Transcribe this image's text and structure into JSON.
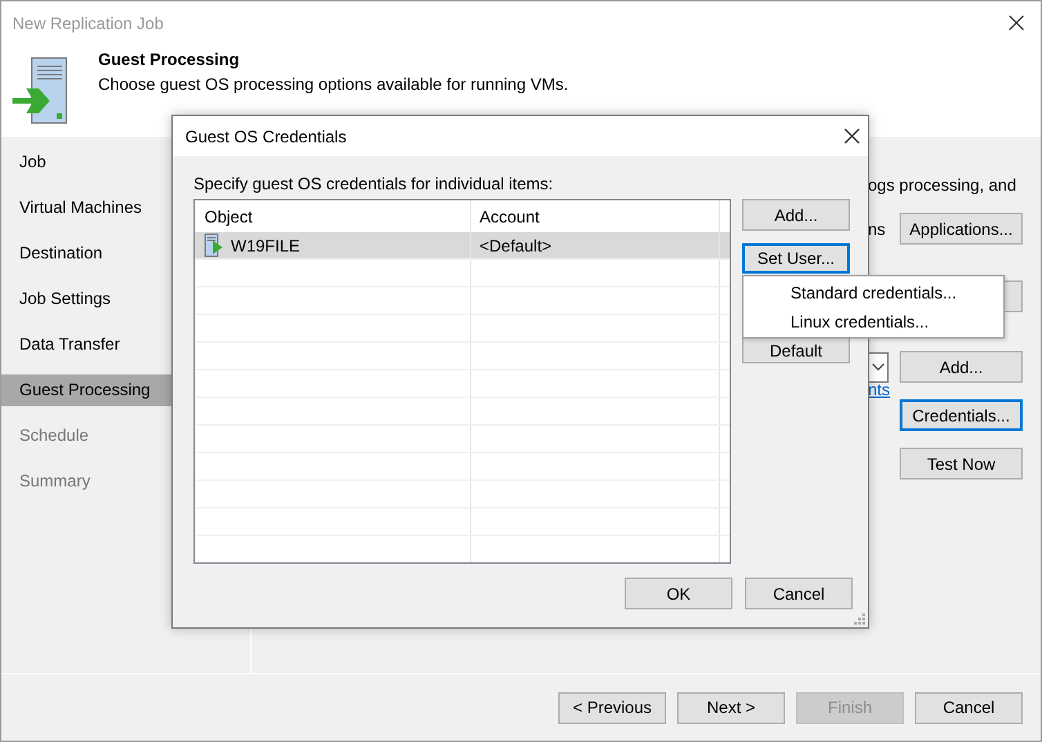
{
  "window": {
    "title": "New Replication Job"
  },
  "header": {
    "title": "Guest Processing",
    "subtitle": "Choose guest OS processing options available for running VMs."
  },
  "steps": [
    {
      "label": "Job",
      "selected": false,
      "disabled": false
    },
    {
      "label": "Virtual Machines",
      "selected": false,
      "disabled": false
    },
    {
      "label": "Destination",
      "selected": false,
      "disabled": false
    },
    {
      "label": "Job Settings",
      "selected": false,
      "disabled": false
    },
    {
      "label": "Data Transfer",
      "selected": false,
      "disabled": false
    },
    {
      "label": "Guest Processing",
      "selected": true,
      "disabled": false
    },
    {
      "label": "Schedule",
      "selected": false,
      "disabled": true
    },
    {
      "label": "Summary",
      "selected": false,
      "disabled": true
    }
  ],
  "main_panel": {
    "text_1": "ogs processing, and",
    "text_2": "ns",
    "applications_button": "Applications...",
    "add_button": "Add...",
    "link": "nts",
    "credentials_button": {
      "label": "Credentials...",
      "focused": true
    },
    "test_now_button": {
      "label": "Test Now",
      "focused": false
    }
  },
  "dialog": {
    "title": "Guest OS Credentials",
    "instruction": "Specify guest OS credentials for individual items:",
    "table": {
      "columns": [
        "Object",
        "Account"
      ],
      "rows": [
        {
          "object": "W19FILE",
          "account": "<Default>",
          "selected": true
        }
      ]
    },
    "side_buttons": [
      {
        "label": "Add...",
        "focused": false
      },
      {
        "label": "Set User...",
        "focused": true
      },
      {
        "label": "Default",
        "focused": false
      }
    ],
    "menu": {
      "items": [
        "Standard credentials...",
        "Linux credentials..."
      ]
    },
    "buttons": [
      "OK",
      "Cancel"
    ]
  },
  "footer_buttons": [
    {
      "label": "< Previous",
      "disabled": false
    },
    {
      "label": "Next >",
      "disabled": false
    },
    {
      "label": "Finish",
      "disabled": true
    },
    {
      "label": "Cancel",
      "disabled": false
    }
  ]
}
